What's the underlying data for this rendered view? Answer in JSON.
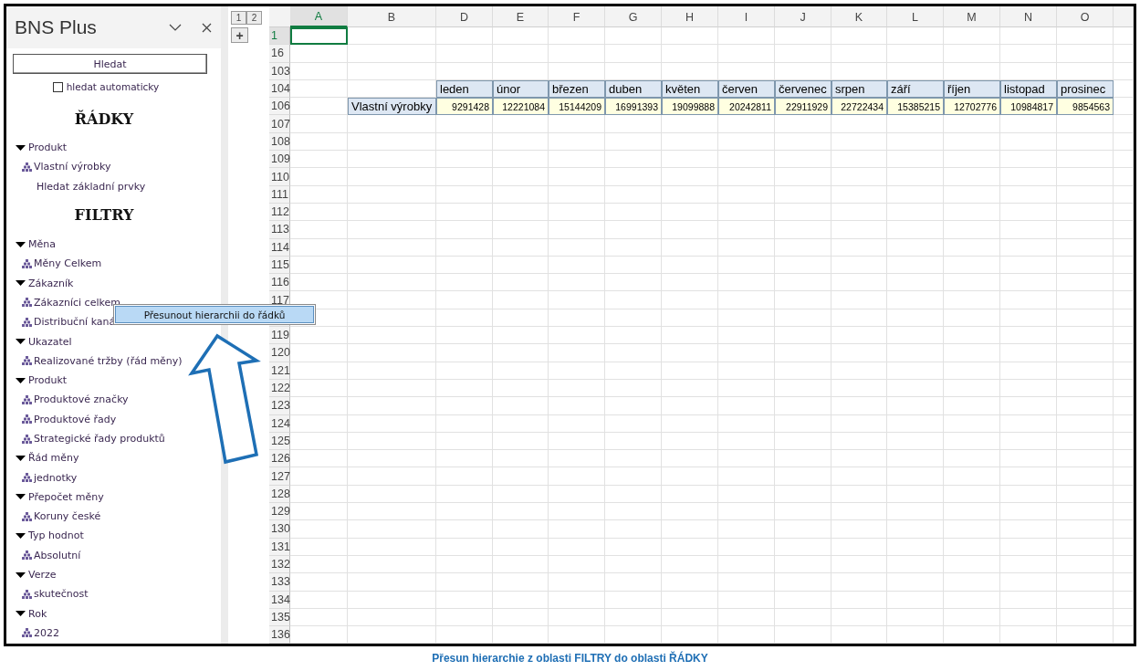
{
  "panel": {
    "title": "BNS Plus",
    "search_button": "Hledat",
    "auto_search": {
      "label": "hledat automaticky",
      "checked": false
    },
    "sections": [
      {
        "heading": "ŘÁDKY",
        "groups": [
          {
            "label": "Produkt",
            "expanded": true,
            "children": [
              {
                "kind": "hierarchy",
                "label": "Vlastní výrobky"
              },
              {
                "kind": "search",
                "label": "Hledat základní prvky"
              }
            ]
          }
        ]
      },
      {
        "heading": "FILTRY",
        "groups": [
          {
            "label": "Měna",
            "expanded": true,
            "children": [
              {
                "kind": "hierarchy",
                "label": "Měny Celkem"
              }
            ]
          },
          {
            "label": "Zákazník",
            "expanded": true,
            "children": [
              {
                "kind": "hierarchy",
                "label": "Zákazníci celkem"
              },
              {
                "kind": "hierarchy",
                "label": "Distribuční kaná"
              }
            ]
          },
          {
            "label": "Ukazatel",
            "expanded": true,
            "children": [
              {
                "kind": "hierarchy",
                "label": "Realizované tržby (řád měny)"
              }
            ]
          },
          {
            "label": "Produkt",
            "expanded": true,
            "children": [
              {
                "kind": "hierarchy",
                "label": "Produktové značky"
              },
              {
                "kind": "hierarchy",
                "label": "Produktové řady"
              },
              {
                "kind": "hierarchy",
                "label": "Strategické řady produktů"
              }
            ]
          },
          {
            "label": "Řád měny",
            "expanded": true,
            "children": [
              {
                "kind": "hierarchy",
                "label": "jednotky"
              }
            ]
          },
          {
            "label": "Přepočet měny",
            "expanded": true,
            "children": [
              {
                "kind": "hierarchy",
                "label": "Koruny české"
              }
            ]
          },
          {
            "label": "Typ hodnot",
            "expanded": true,
            "children": [
              {
                "kind": "hierarchy",
                "label": "Absolutní"
              }
            ]
          },
          {
            "label": "Verze",
            "expanded": true,
            "children": [
              {
                "kind": "hierarchy",
                "label": "skutečnost"
              }
            ]
          },
          {
            "label": "Rok",
            "expanded": true,
            "children": [
              {
                "kind": "hierarchy",
                "label": "2022"
              }
            ]
          }
        ]
      }
    ]
  },
  "sheet": {
    "outline_levels": [
      "1",
      "2"
    ],
    "outline_toggle": "+",
    "columns": [
      {
        "label": "A",
        "selected": true
      },
      {
        "label": "B",
        "selected": false
      },
      {
        "label": "D",
        "selected": false
      },
      {
        "label": "E",
        "selected": false
      },
      {
        "label": "F",
        "selected": false
      },
      {
        "label": "G",
        "selected": false
      },
      {
        "label": "H",
        "selected": false
      },
      {
        "label": "I",
        "selected": false
      },
      {
        "label": "J",
        "selected": false
      },
      {
        "label": "K",
        "selected": false
      },
      {
        "label": "L",
        "selected": false
      },
      {
        "label": "M",
        "selected": false
      },
      {
        "label": "N",
        "selected": false
      },
      {
        "label": "O",
        "selected": false
      }
    ],
    "rows": [
      {
        "number": "1",
        "selected": true
      },
      {
        "number": "16",
        "selected": false
      },
      {
        "number": "103",
        "selected": false
      },
      {
        "number": "104",
        "selected": false
      },
      {
        "number": "106",
        "selected": false
      },
      {
        "number": "107",
        "selected": false
      },
      {
        "number": "108",
        "selected": false
      },
      {
        "number": "109",
        "selected": false
      },
      {
        "number": "110",
        "selected": false
      },
      {
        "number": "111",
        "selected": false
      },
      {
        "number": "112",
        "selected": false
      },
      {
        "number": "113",
        "selected": false
      },
      {
        "number": "114",
        "selected": false
      },
      {
        "number": "115",
        "selected": false
      },
      {
        "number": "116",
        "selected": false
      },
      {
        "number": "117",
        "selected": false
      },
      {
        "selected": false
      },
      {
        "number": "119",
        "selected": false
      },
      {
        "number": "120",
        "selected": false
      },
      {
        "number": "121",
        "selected": false
      },
      {
        "number": "122",
        "selected": false
      },
      {
        "number": "123",
        "selected": false
      },
      {
        "number": "124",
        "selected": false
      },
      {
        "number": "125",
        "selected": false
      },
      {
        "number": "126",
        "selected": false
      },
      {
        "number": "127",
        "selected": false
      },
      {
        "number": "128",
        "selected": false
      },
      {
        "number": "129",
        "selected": false
      },
      {
        "number": "130",
        "selected": false
      },
      {
        "number": "131",
        "selected": false
      },
      {
        "number": "132",
        "selected": false
      },
      {
        "number": "133",
        "selected": false
      },
      {
        "number": "134",
        "selected": false
      },
      {
        "number": "135",
        "selected": false
      },
      {
        "number": "136",
        "selected": false
      }
    ],
    "pivot": {
      "row_label": "Vlastní výrobky",
      "months": [
        "leden",
        "únor",
        "březen",
        "duben",
        "květen",
        "červen",
        "červenec",
        "srpen",
        "září",
        "říjen",
        "listopad",
        "prosinec"
      ],
      "values": [
        "9291428",
        "12221084",
        "15144209",
        "16991393",
        "19099888",
        "20242811",
        "22911929",
        "22722434",
        "15385215",
        "12702776",
        "10984817",
        "9854563"
      ]
    }
  },
  "context_menu": {
    "label": "Přesunout hierarchii do řádků"
  },
  "caption": "Přesun hierarchie z oblasti FILTRY do oblasti ŘÁDKY"
}
